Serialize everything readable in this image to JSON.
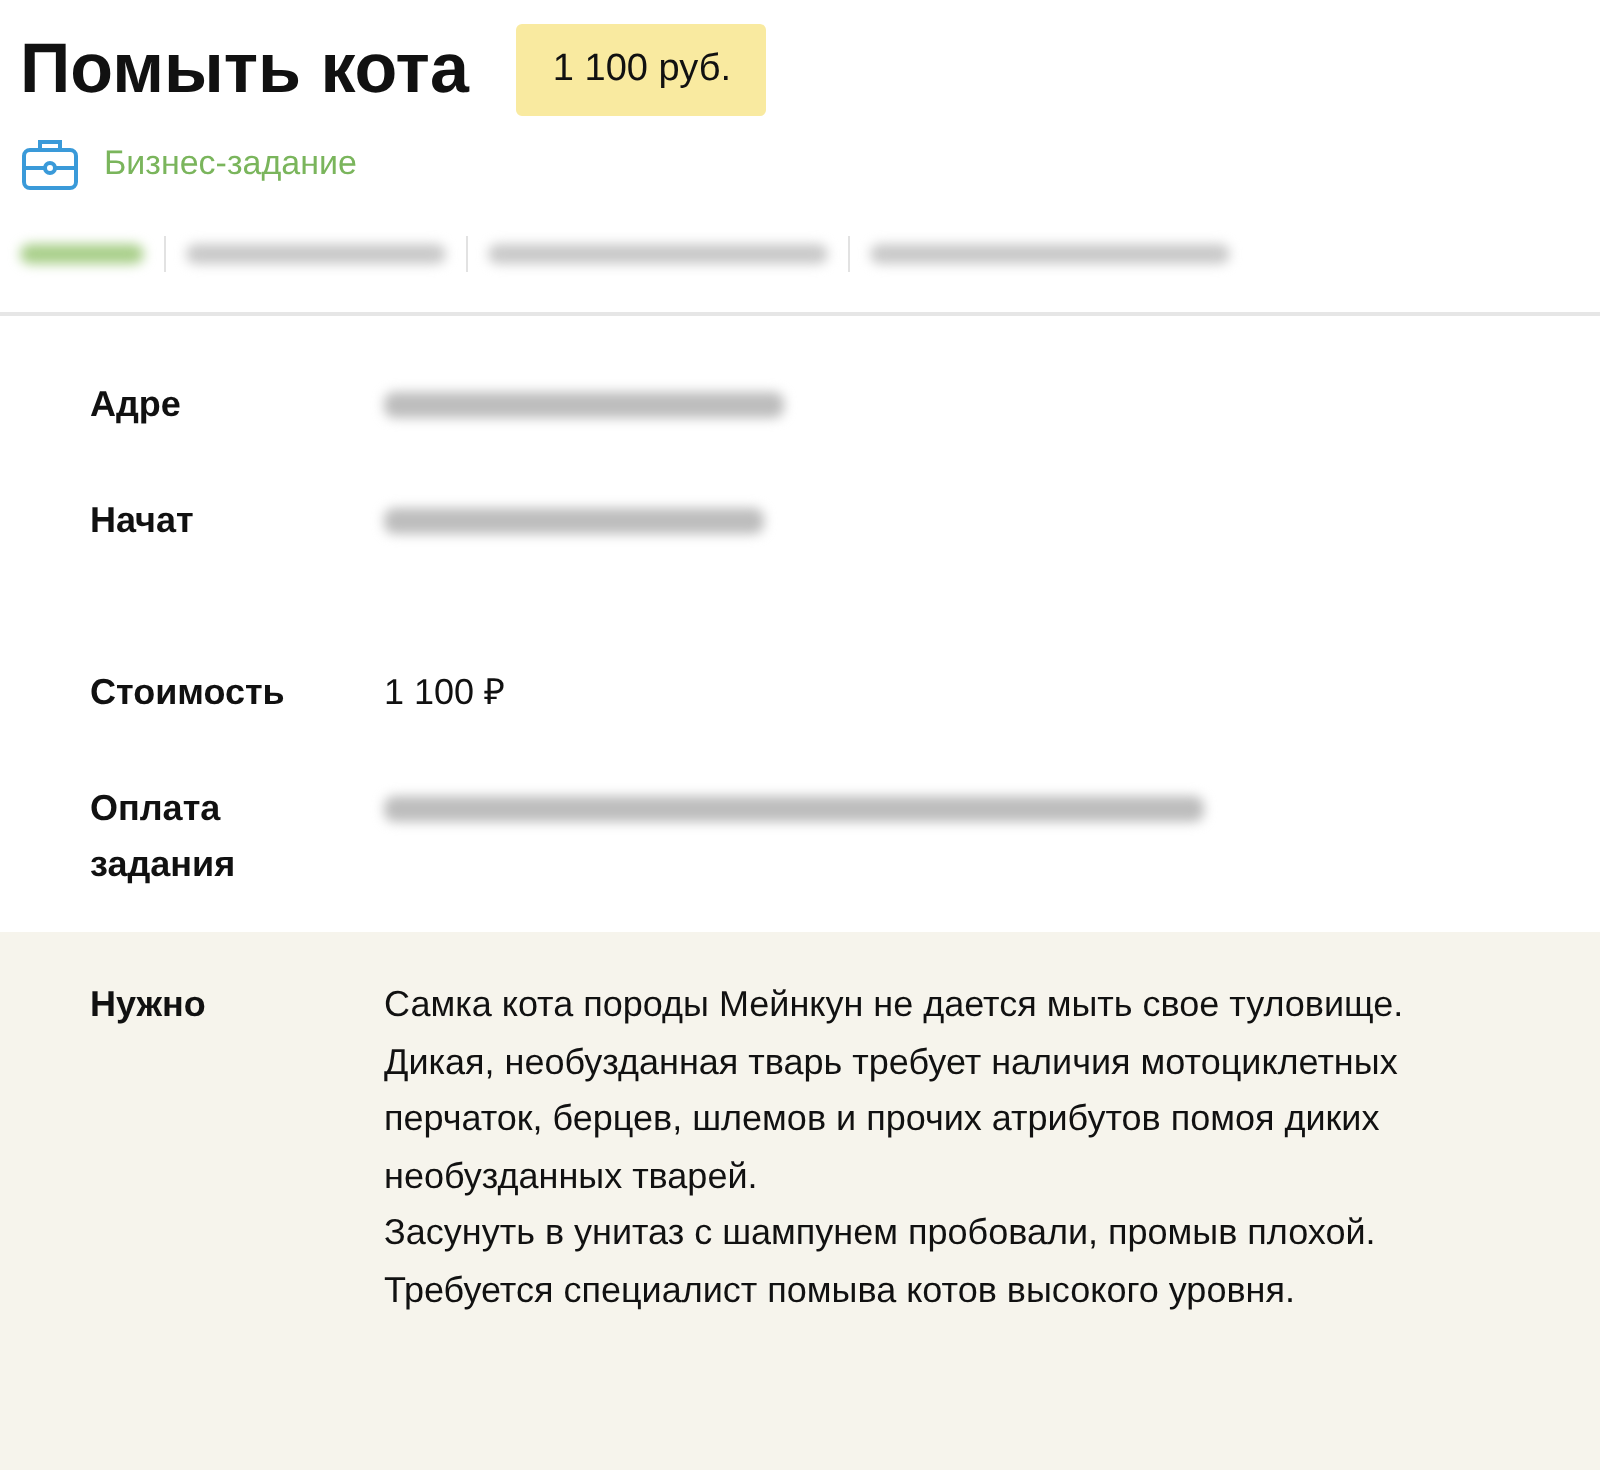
{
  "title": "Помыть кота",
  "price_badge": "1 100 руб.",
  "category": {
    "label": "Бизнес-задание"
  },
  "tabs": [
    {
      "kind": "blurred",
      "selected": true
    },
    {
      "kind": "blurred",
      "selected": false
    },
    {
      "kind": "blurred",
      "selected": false
    },
    {
      "kind": "blurred",
      "selected": false
    }
  ],
  "details": [
    {
      "label": "Адре",
      "kind": "blurred"
    },
    {
      "label": "Начат",
      "kind": "blurred"
    },
    {
      "label": "Стоимость",
      "kind": "text",
      "value": "1 100 ₽"
    },
    {
      "label": "Оплата задания",
      "kind": "blurred"
    }
  ],
  "need": {
    "label": "Нужно",
    "lines": [
      "Самка кота породы Мейнкун не дается мыть свое туловище.",
      "Дикая, необузданная тварь требует наличия мотоциклетных перчаток, берцев, шлемов и прочих атрибутов помоя диких необузданных тварей.",
      "Засунуть в унитаз с шампунем пробовали, промыв плохой.",
      "Требуется специалист помыва котов высокого уровня."
    ]
  }
}
